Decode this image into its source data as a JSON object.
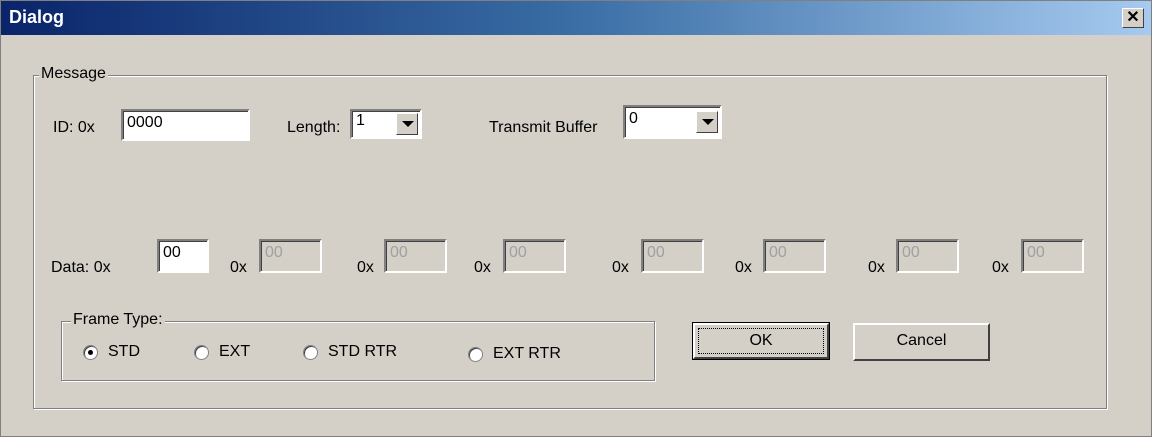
{
  "window": {
    "title": "Dialog",
    "close_glyph": "✕",
    "close_icon": "close-icon"
  },
  "message_group": {
    "legend": "Message",
    "id_label": "ID:  0x",
    "id_value": "0000",
    "length_label": "Length:",
    "length_value": "1",
    "transmit_label": "Transmit Buffer",
    "transmit_value": "0"
  },
  "data_row": {
    "label": "Data:  0x",
    "prefix": "0x",
    "bytes": [
      "00",
      "00",
      "00",
      "00",
      "00",
      "00",
      "00",
      "00"
    ],
    "enabled_count": 1
  },
  "frame_type": {
    "legend": "Frame Type:",
    "options": [
      "STD",
      "EXT",
      "STD RTR",
      "EXT RTR"
    ],
    "selected": "STD"
  },
  "buttons": {
    "ok": "OK",
    "cancel": "Cancel"
  }
}
